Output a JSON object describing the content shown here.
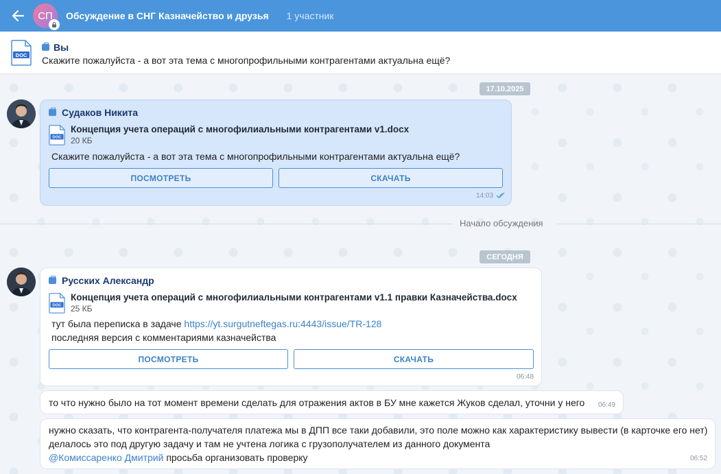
{
  "header": {
    "avatar_initials": "СП",
    "title": "Обсуждение в СНГ Казначейство и друзья",
    "members": "1 участник"
  },
  "pinned": {
    "author": "Вы",
    "text": "Скажите пожалуйста - а вот эта тема с многопрофильными контрагентами актуальна ещё?",
    "file_icon_label": "DOC"
  },
  "dates": {
    "first": "17.10.2025",
    "today": "СЕГОДНЯ"
  },
  "divider": {
    "label": "Начало обсуждения"
  },
  "messages": [
    {
      "author": "Судаков Никита",
      "file_name": "Концепция учета операций с многофилиальными контрагентами v1.docx",
      "file_size": "20 КБ",
      "file_icon_label": "DOC",
      "text": "Скажите пожалуйста - а вот эта тема с многопрофильными контрагентами актуальна ещё?",
      "view_label": "ПОСМОТРЕТЬ",
      "download_label": "СКАЧАТЬ",
      "time": "14:03"
    },
    {
      "author": "Русских Александр",
      "file_name": "Концепция учета операций с многофилиальными контрагентами v1.1 правки Казначейства.docx",
      "file_size": "25 КБ",
      "file_icon_label": "DOC",
      "text_prefix": "тут была переписка в задаче",
      "link": "https://yt.surgutneftegas.ru:4443/issue/TR-128",
      "text_line2": "последняя версия с комментариями казначейства",
      "view_label": "ПОСМОТРЕТЬ",
      "download_label": "СКАЧАТЬ",
      "time": "06:48"
    },
    {
      "text": "то что нужно было на тот момент времени сделать для отражения актов в БУ мне кажется Жуков сделал, уточни у него",
      "time": "06:49"
    },
    {
      "line1": "нужно сказать, что контрагента-получателя платежа мы в ДПП все таки добавили, это поле можно как характеристику вывести (в карточке его нет)",
      "line2": "делалось это под другую задачу и там не учтена логика с грузополучателем из данного документа",
      "mention": "@Комиссаренко Дмитрий",
      "line3_rest": "просьба организовать проверку",
      "time": "06:52"
    }
  ],
  "colors": {
    "header_bg": "#4a95dc",
    "accent": "#3a82c8",
    "mine_bubble": "#d6e6fb"
  }
}
